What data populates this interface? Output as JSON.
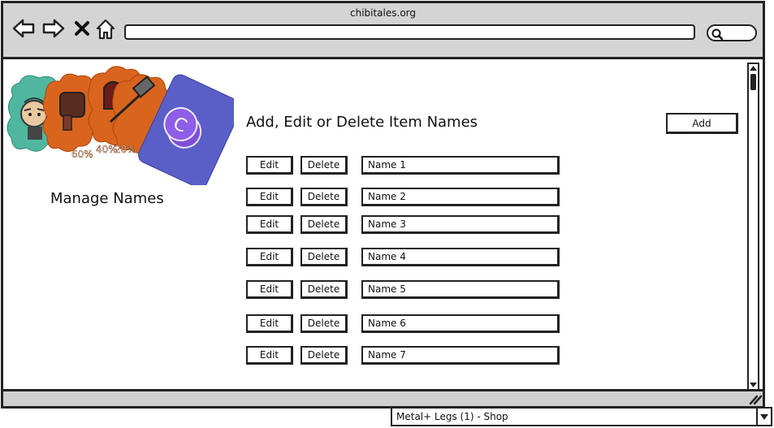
{
  "browser": {
    "url_title": "chibitales.org",
    "address": "",
    "search": ""
  },
  "sidebar": {
    "manage_label": "Manage Names",
    "logo_badges": [
      "60%",
      "40%",
      "20%"
    ],
    "logo_coin_letter": "C"
  },
  "main": {
    "heading": "Add, Edit or Delete Item Names",
    "add_label": "Add",
    "edit_label": "Edit",
    "delete_label": "Delete",
    "rows": [
      {
        "name": "Name 1"
      },
      {
        "name": "Name 2"
      },
      {
        "name": "Name 3"
      },
      {
        "name": "Name 4"
      },
      {
        "name": "Name 5"
      },
      {
        "name": "Name 6"
      },
      {
        "name": "Name 7"
      }
    ]
  },
  "footer": {
    "dropdown_value": "Metal+ Legs (1) - Shop"
  },
  "colors": {
    "chrome": "#d4d4d4",
    "teal": "#4fb7a0",
    "orange": "#d9641e",
    "purple": "#5a5fc8"
  }
}
